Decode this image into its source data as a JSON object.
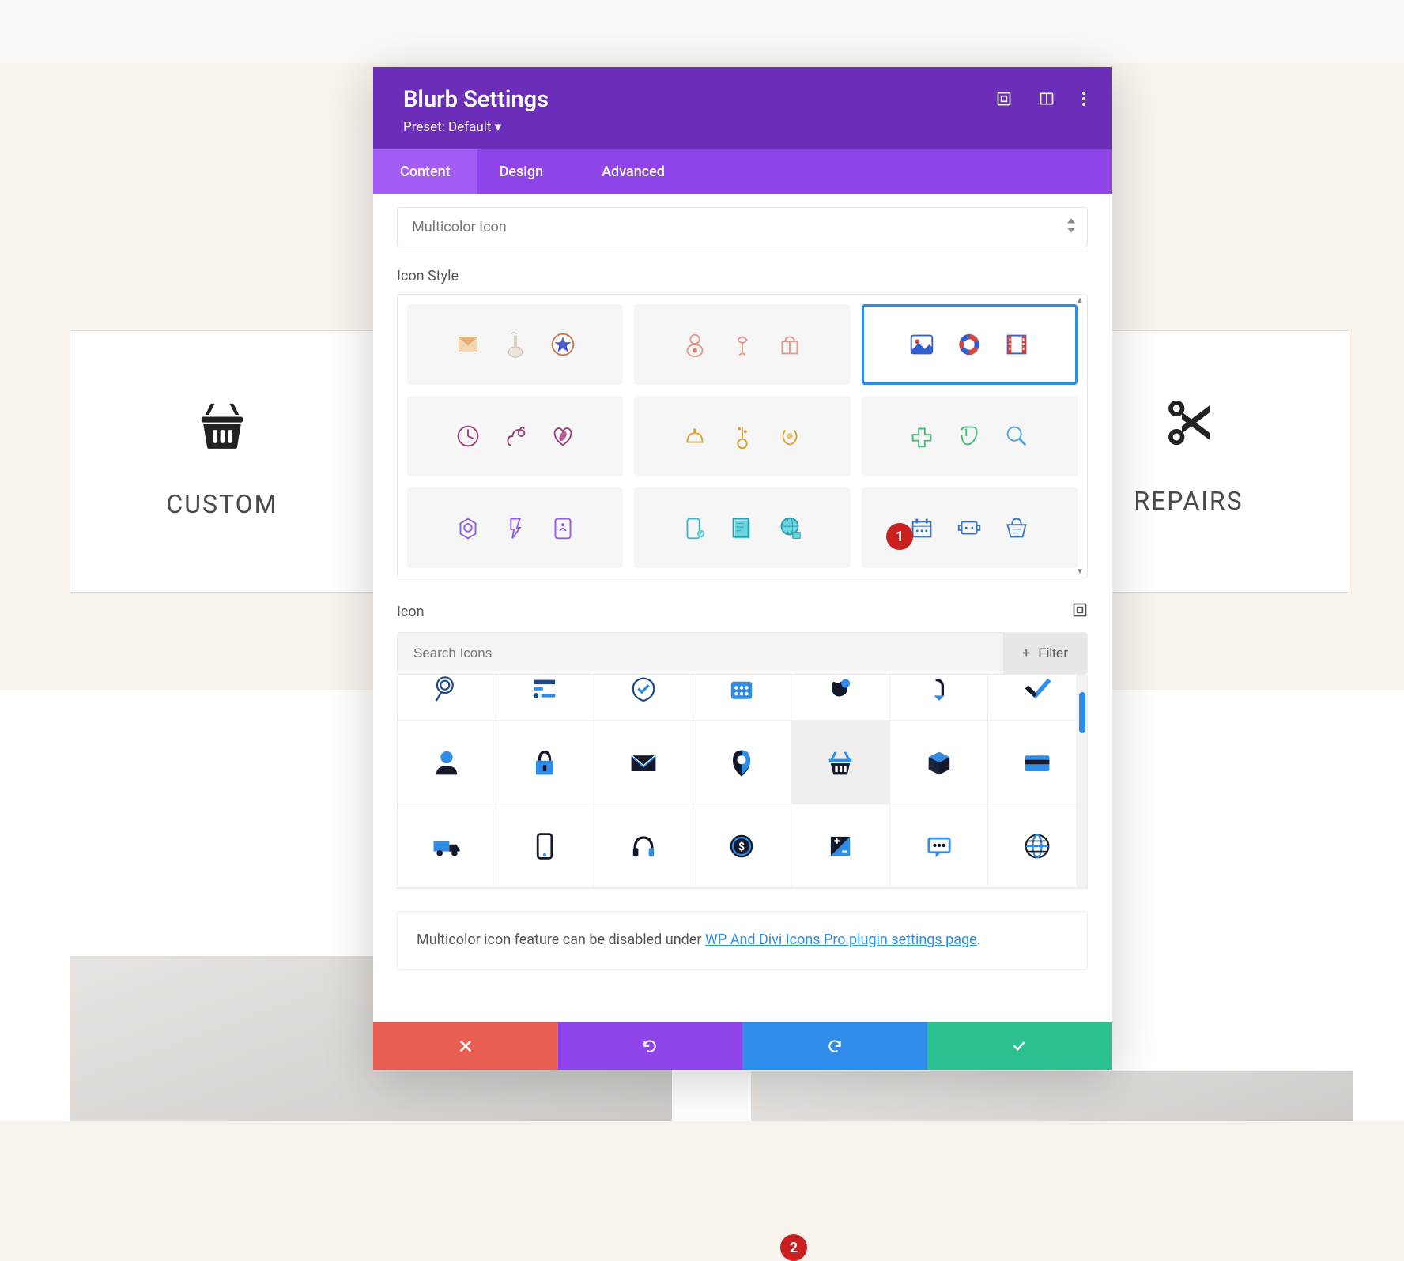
{
  "header": {
    "title": "Blurb Settings",
    "preset": "Preset: Default",
    "icons": [
      "preview-icon",
      "split-view-icon",
      "more-icon"
    ]
  },
  "tabs": {
    "content": "Content",
    "design": "Design",
    "advanced": "Advanced",
    "active": "content"
  },
  "imageType": {
    "value": "Multicolor Icon"
  },
  "iconStyle": {
    "label": "Icon Style",
    "selectedIndex": 2
  },
  "iconSection": {
    "label": "Icon",
    "searchPlaceholder": "Search Icons",
    "filterLabel": "Filter"
  },
  "note": {
    "prefix": "Multicolor icon feature can be disabled under ",
    "link": "WP And Divi Icons Pro plugin settings page",
    "suffix": "."
  },
  "markers": {
    "one": "1",
    "two": "2"
  },
  "cards": {
    "custom": "CUSTOM",
    "repairs": "REPAIRS"
  }
}
